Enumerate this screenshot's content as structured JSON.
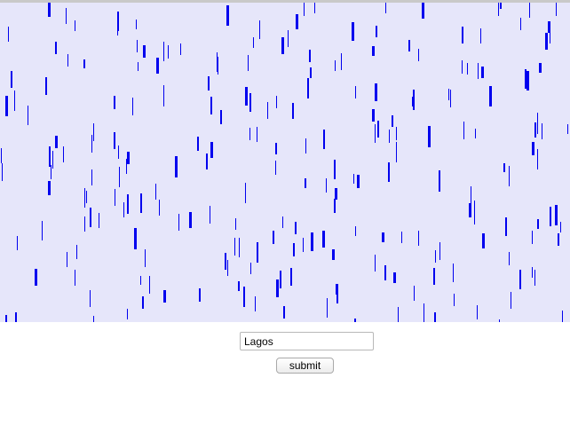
{
  "canvas": {
    "background": "#e6e6fa",
    "drop_color": "#0000ee"
  },
  "form": {
    "input_value": "Lagos",
    "submit_label": "submit"
  }
}
